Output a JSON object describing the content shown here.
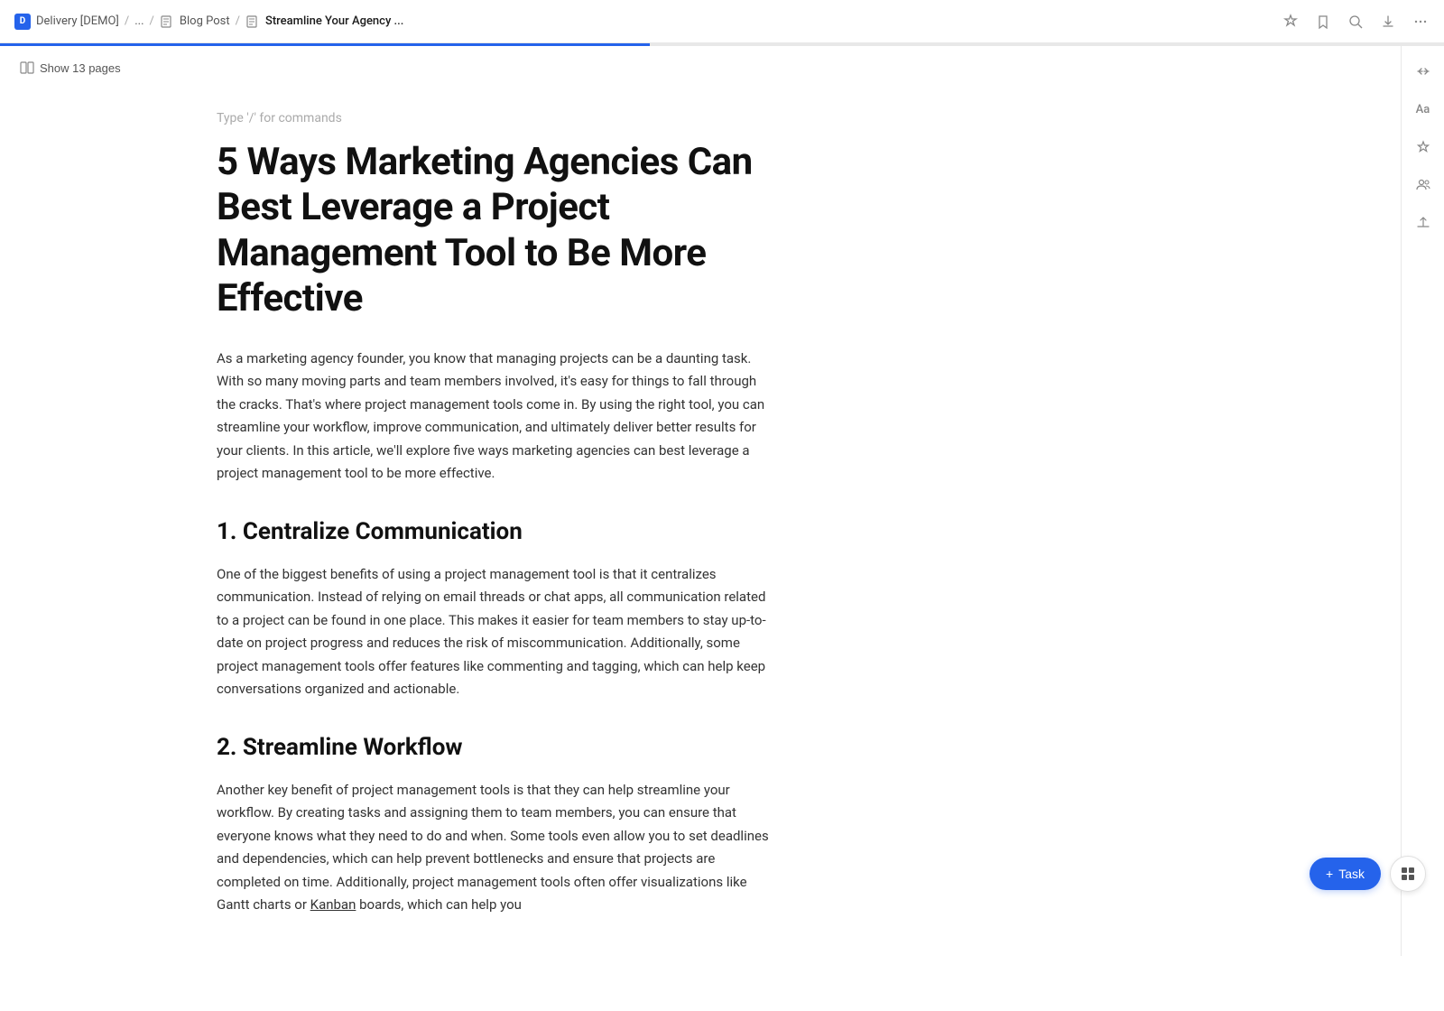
{
  "topbar": {
    "app_name": "Delivery [DEMO]",
    "sep1": "/",
    "ellipsis": "...",
    "sep2": "/",
    "breadcrumb2": "Blog Post",
    "sep3": "/",
    "breadcrumb3": "Streamline Your Agency ...",
    "icons": {
      "bookmark": "☆",
      "search": "⌕",
      "download": "⬇",
      "more": "···"
    }
  },
  "sidebar": {
    "show_pages_label": "Show 13 pages"
  },
  "command_placeholder": "Type '/' for commands",
  "document": {
    "title": "5 Ways Marketing Agencies Can Best Leverage a Project Management Tool to Be More Effective",
    "intro": "As a marketing agency founder, you know that managing projects can be a daunting task. With so many moving parts and team members involved, it's easy for things to fall through the cracks. That's where project management tools come in. By using the right tool, you can streamline your workflow, improve communication, and ultimately deliver better results for your clients. In this article, we'll explore five ways marketing agencies can best leverage a project management tool to be more effective.",
    "h2_1": "1. Centralize Communication",
    "p1": "One of the biggest benefits of using a project management tool is that it centralizes communication. Instead of relying on email threads or chat apps, all communication related to a project can be found in one place. This makes it easier for team members to stay up-to-date on project progress and reduces the risk of miscommunication. Additionally, some project management tools offer features like commenting and tagging, which can help keep conversations organized and actionable.",
    "h2_2": "2. Streamline Workflow",
    "p2": "Another key benefit of project management tools is that they can help streamline your workflow. By creating tasks and assigning them to team members, you can ensure that everyone knows what they need to do and when. Some tools even allow you to set deadlines and dependencies, which can help prevent bottlenecks and ensure that projects are completed on time. Additionally, project management tools often offer visualizations like Gantt charts or Kanban boards, which can help you"
  },
  "right_toolbar": {
    "collapse_icon": "⬌",
    "font_icon": "Aa",
    "star_icon": "✦",
    "users_icon": "👥",
    "share_icon": "⬆"
  },
  "bottom_buttons": {
    "task_plus": "+",
    "task_label": "Task",
    "grid_icon": "⠿"
  }
}
